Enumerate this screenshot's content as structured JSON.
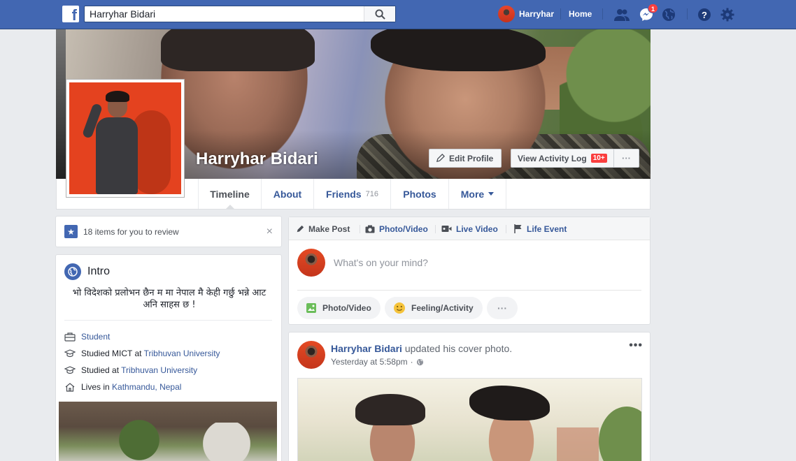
{
  "topbar": {
    "search_value": "Harryhar Bidari",
    "user_name": "Harryhar",
    "home_label": "Home",
    "messages_badge": "1",
    "brand_color": "#4267b2"
  },
  "cover": {
    "profile_name": "Harryhar Bidari",
    "edit_profile_label": "Edit Profile",
    "activity_log_label": "View Activity Log",
    "activity_log_badge": "10+",
    "more_label": "···"
  },
  "nav": {
    "tabs": [
      {
        "label": "Timeline"
      },
      {
        "label": "About"
      },
      {
        "label": "Friends",
        "count": "716"
      },
      {
        "label": "Photos"
      },
      {
        "label": "More"
      }
    ]
  },
  "review": {
    "text": "18 items for you to review",
    "close": "×"
  },
  "intro": {
    "title": "Intro",
    "bio": "भो विदेशको प्रलोभन छैन म मा नेपाल मै केही गर्छु भन्ने आट अनि साहस छ !",
    "rows": [
      {
        "prefix": "",
        "link": "Student"
      },
      {
        "prefix": "Studied MICT at ",
        "link": "Tribhuvan University"
      },
      {
        "prefix": "Studied at ",
        "link": "Tribhuvan University"
      },
      {
        "prefix": "Lives in ",
        "link": "Kathmandu, Nepal"
      }
    ]
  },
  "composer": {
    "tabs": [
      "Make Post",
      "Photo/Video",
      "Live Video",
      "Life Event"
    ],
    "placeholder": "What's on your mind?",
    "pills": [
      "Photo/Video",
      "Feeling/Activity",
      "···"
    ]
  },
  "post": {
    "author": "Harryhar Bidari",
    "action": " updated his cover photo.",
    "time": "Yesterday at 5:58pm",
    "time_sep": "·",
    "more": "•••"
  }
}
